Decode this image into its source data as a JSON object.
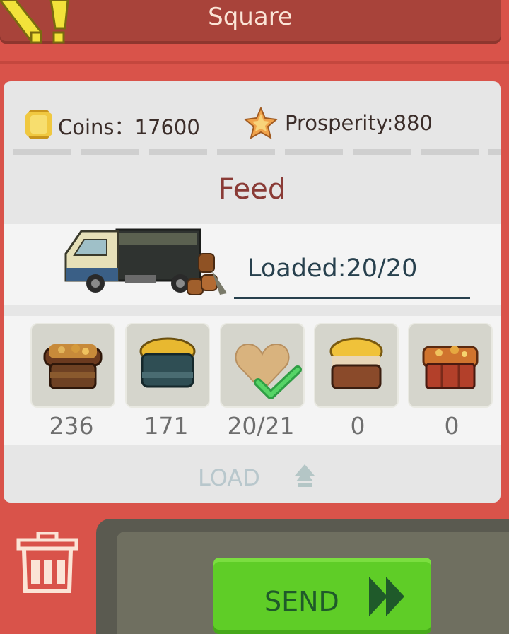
{
  "header": {
    "title": "Square"
  },
  "stats": {
    "coins": "Coins：17600",
    "prosperity": "Prosperity:880"
  },
  "section": {
    "title": "Feed"
  },
  "truck": {
    "loaded": "Loaded:20/20"
  },
  "goods": [
    {
      "name": "feed-bowl-brown",
      "count": "236"
    },
    {
      "name": "feed-bowl-teal",
      "count": "171"
    },
    {
      "name": "heart-feed-selected",
      "count": "20/21"
    },
    {
      "name": "feed-bowl-golden",
      "count": "0"
    },
    {
      "name": "feed-crate-red",
      "count": "0"
    }
  ],
  "actions": {
    "load": "LOAD",
    "send": "SEND"
  },
  "icons": [
    "coin-icon",
    "prosperity-star-icon",
    "truck-icon",
    "check-icon",
    "up-arrow-icon",
    "trash-icon",
    "fast-forward-icon"
  ],
  "colors": {
    "accent_red": "#d9534a",
    "send_green": "#5fcd27",
    "title_red": "#8a3b36"
  }
}
